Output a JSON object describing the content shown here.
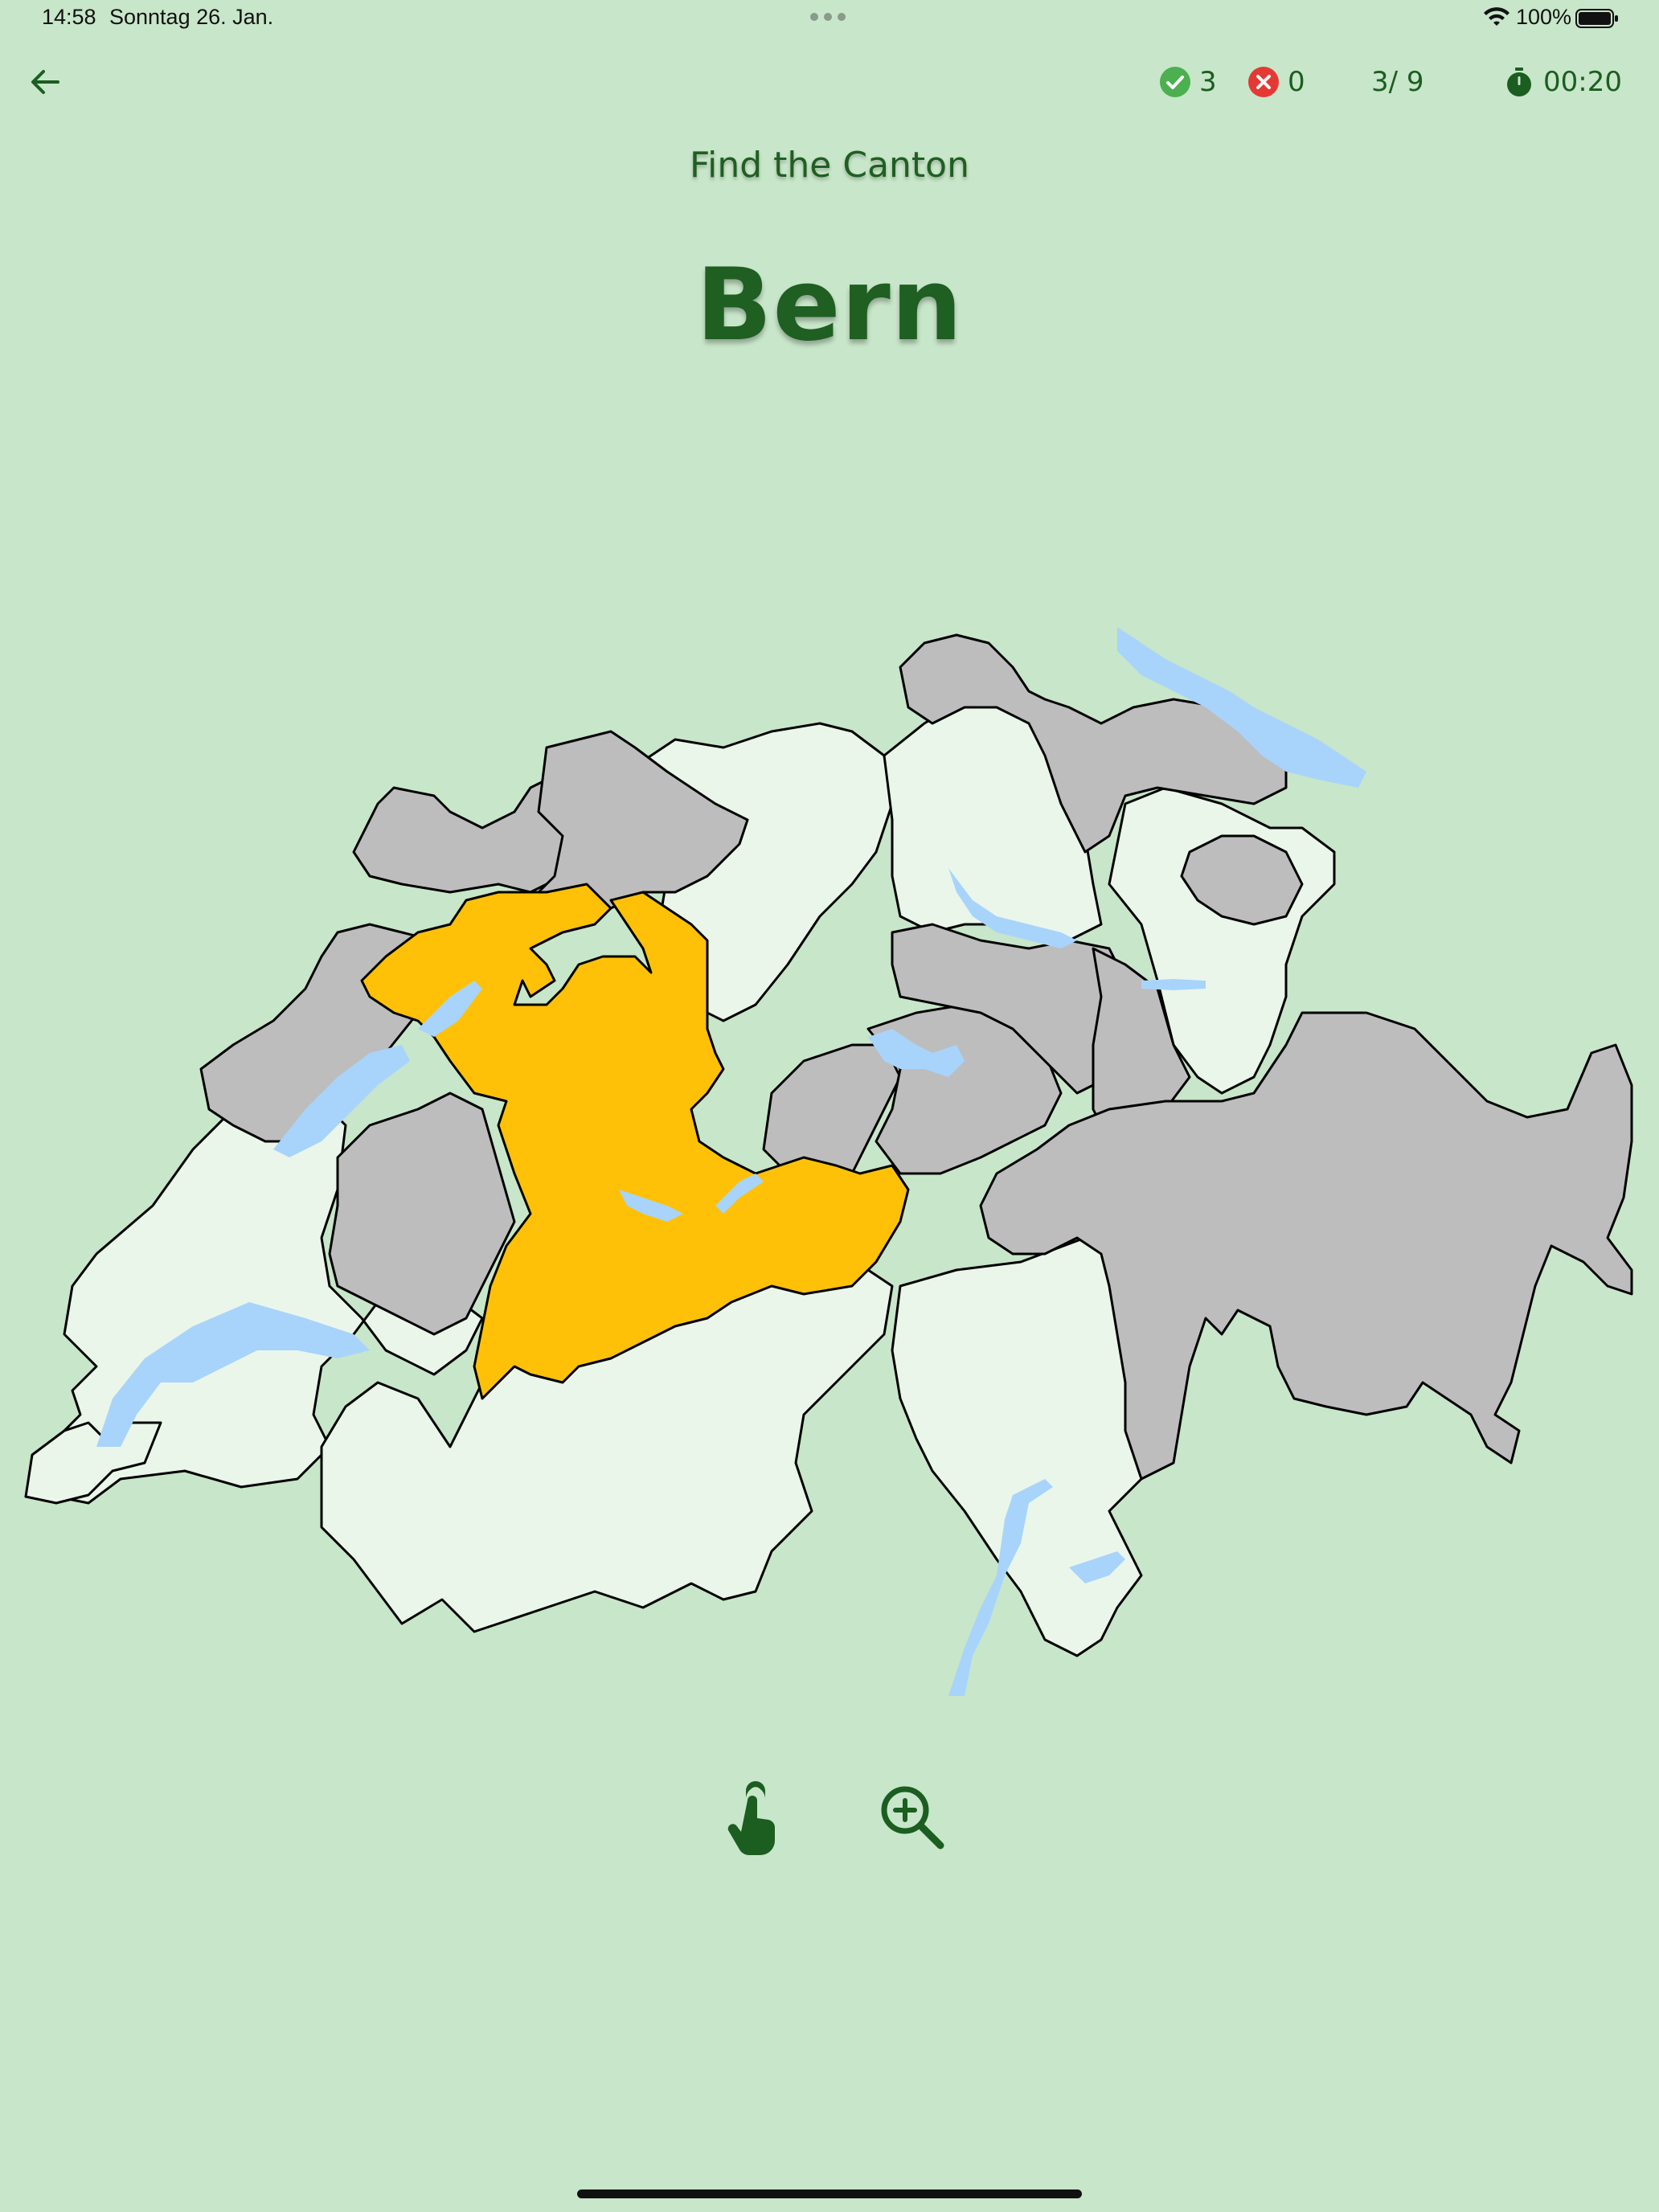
{
  "status_bar": {
    "time": "14:58",
    "date": "Sonntag 26. Jan.",
    "battery": "100%"
  },
  "header": {
    "correct_count": "3",
    "wrong_count": "0",
    "progress": "3/ 9",
    "timer": "00:20"
  },
  "quiz": {
    "prompt": "Find the Canton",
    "target": "Bern"
  },
  "map": {
    "highlighted_canton_color": "#ffc107",
    "found_canton_color": "#bdbdbd",
    "remaining_canton_color": "#eaf6ea",
    "lake_color": "#a8d4fb",
    "border_color": "#000000"
  },
  "colors": {
    "background": "#c8e6c9",
    "accent": "#1b5e20",
    "correct": "#4caf50",
    "wrong": "#e53935"
  },
  "toolbar": {
    "tap_icon": "tap-finger-icon",
    "zoom_icon": "zoom-in-icon"
  }
}
